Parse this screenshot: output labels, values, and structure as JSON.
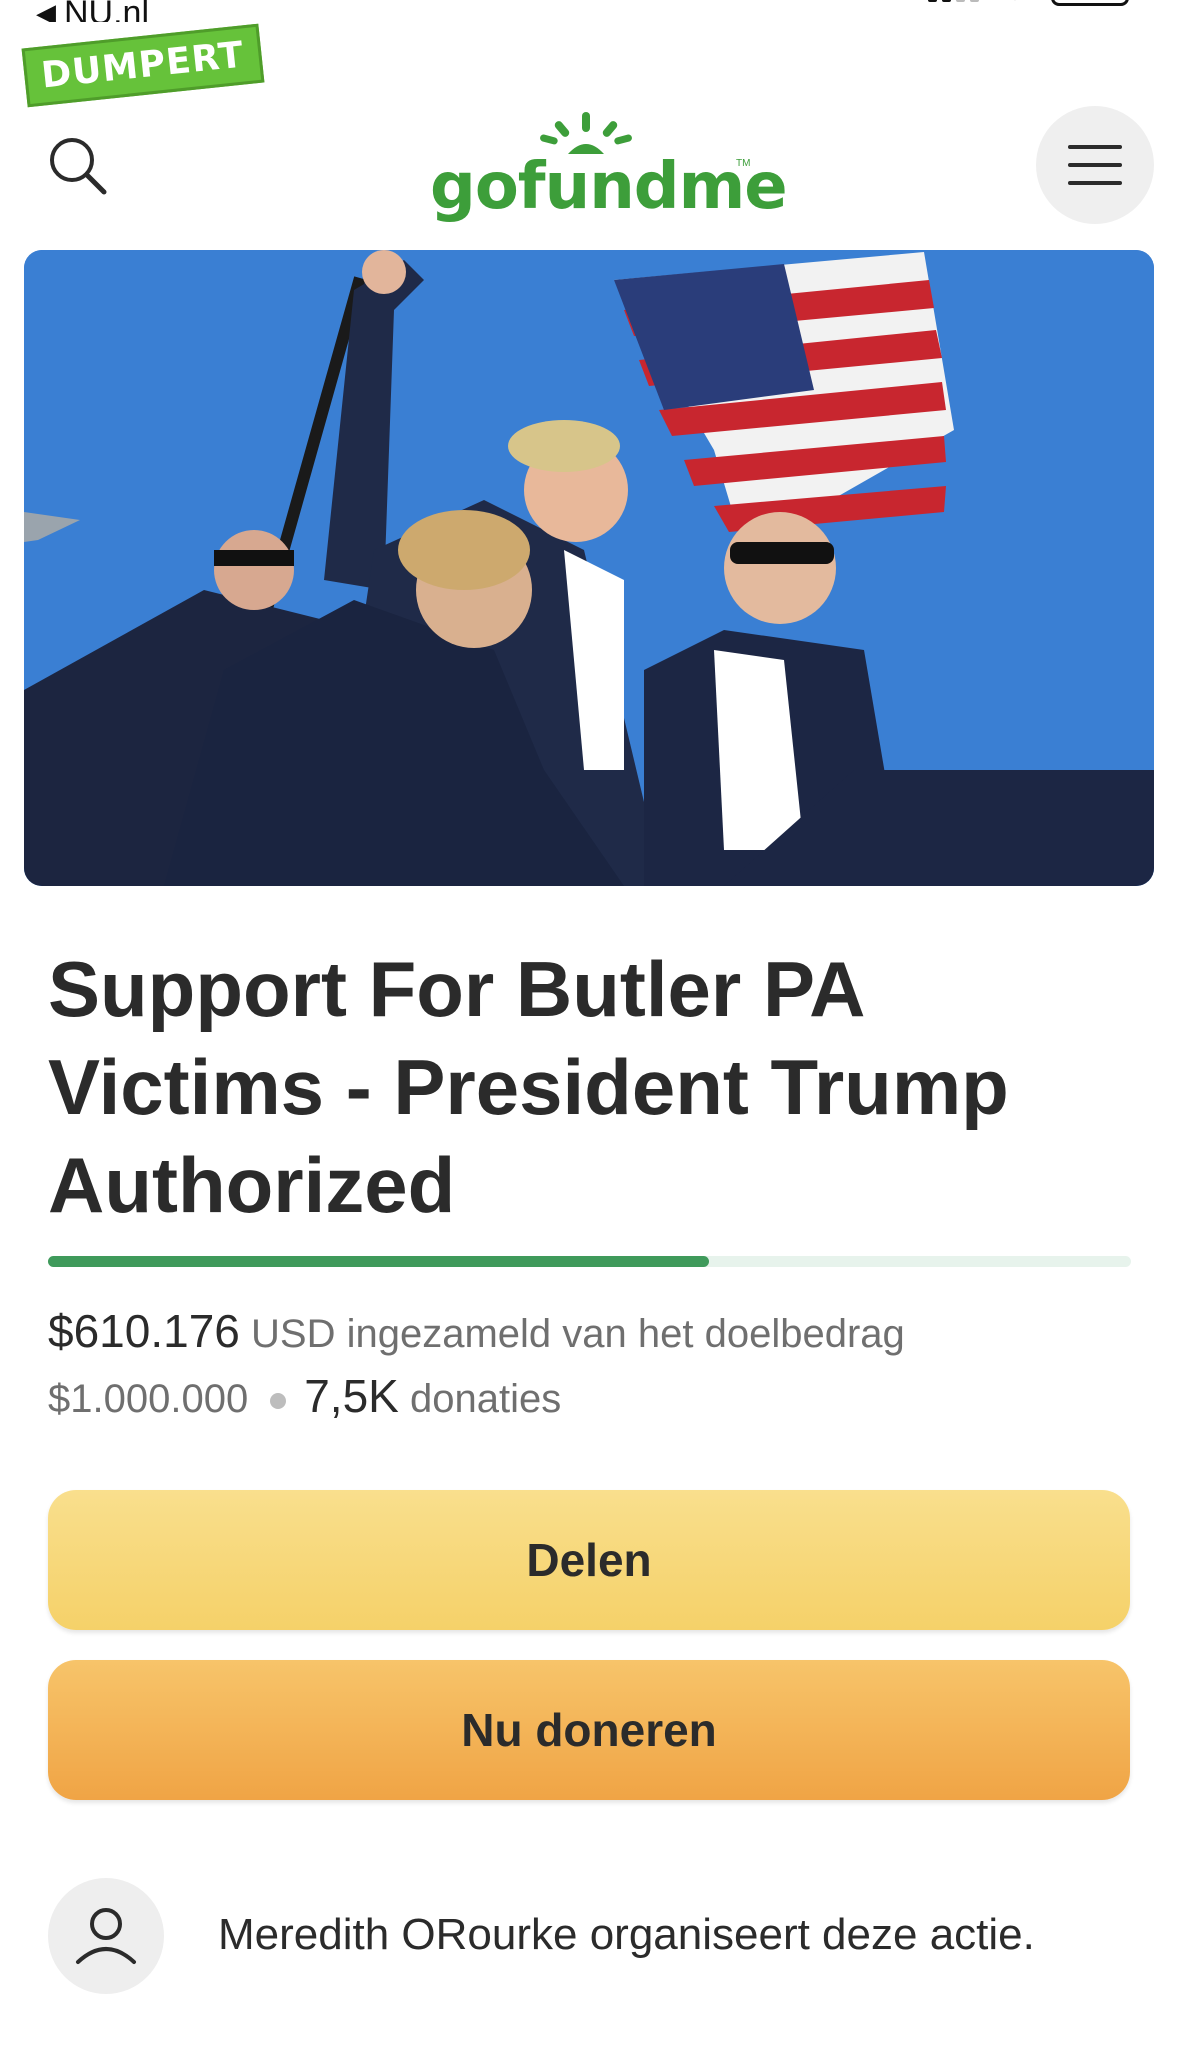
{
  "status_bar": {
    "back_label": "NU.nl"
  },
  "watermark": {
    "text": "DUMPERT"
  },
  "header": {
    "logo_text": "gofundme",
    "logo_tm": "TM"
  },
  "campaign": {
    "title": "Support For Butler PA Victims - President Trump Authorized",
    "progress": 0.61,
    "raised_amount": "$610.176",
    "raised_suffix": "USD ingezameld van het doelbedrag",
    "goal_amount": "$1.000.000",
    "donations_count": "7,5K",
    "donations_label": "donaties"
  },
  "actions": {
    "share_label": "Delen",
    "donate_label": "Nu doneren"
  },
  "organizer": {
    "text": "Meredith ORourke organiseert deze actie."
  },
  "colors": {
    "brand_green": "#3d9e3a",
    "progress_green": "#3f9a5b",
    "share_yellow": "#f5d169",
    "donate_orange": "#f0a445"
  }
}
